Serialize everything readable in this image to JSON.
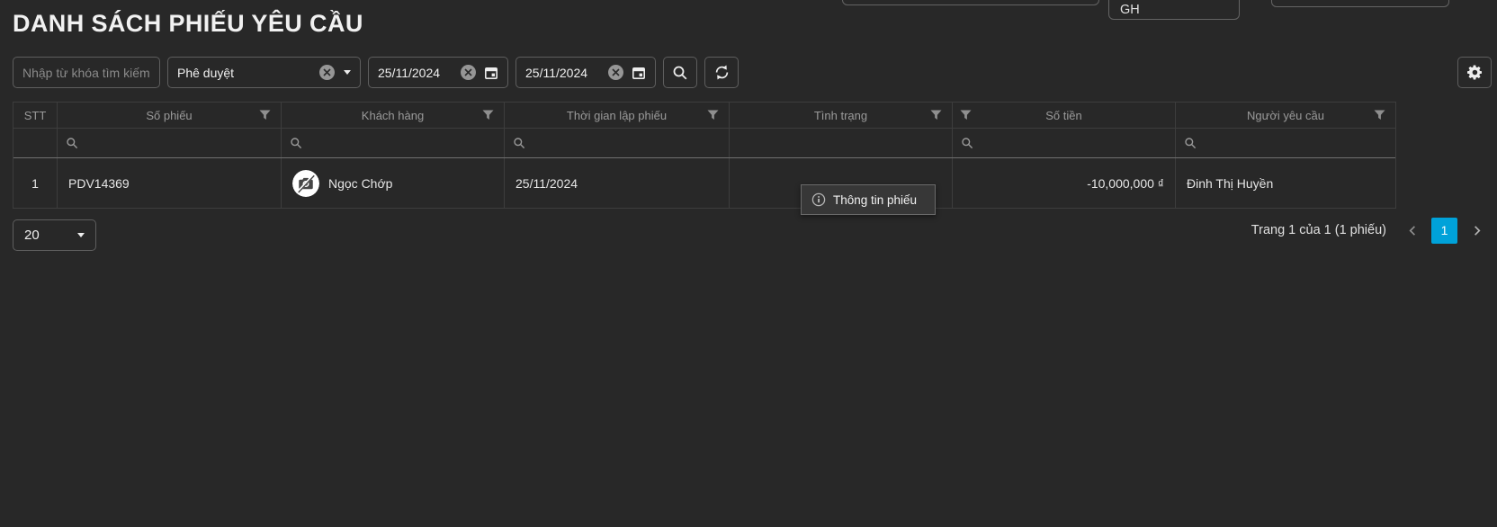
{
  "page": {
    "title": "DANH SÁCH PHIẾU YÊU CẦU"
  },
  "top_edge": {
    "partial_input_value": "GH"
  },
  "toolbar": {
    "search_placeholder": "Nhập từ khóa tìm kiếm",
    "status_filter_value": "Phê duyệt",
    "date_from": "25/11/2024",
    "date_to": "25/11/2024"
  },
  "table": {
    "columns": [
      {
        "label": "STT",
        "filter": false
      },
      {
        "label": "Số phiếu",
        "filter": true
      },
      {
        "label": "Khách hàng",
        "filter": true
      },
      {
        "label": "Thời gian lập phiếu",
        "filter": true
      },
      {
        "label": "Tình trạng",
        "filter": true
      },
      {
        "label": "Số tiền",
        "filter": true
      },
      {
        "label": "Người yêu cầu",
        "filter": true
      }
    ],
    "rows": [
      {
        "stt": "1",
        "so_phieu": "PDV14369",
        "khach_hang": "Ngọc Chớp",
        "thoi_gian_lap_phieu": "25/11/2024",
        "tinh_trang": "",
        "so_tien": "-10,000,000 ₫",
        "nguoi_yeu_cau": "Đinh Thị Huyền"
      }
    ],
    "row_tooltip": {
      "label": "Thông tin phiếu"
    }
  },
  "pager": {
    "page_size": "20",
    "info": "Trang 1 của 1 (1 phiếu)",
    "current_page": "1"
  },
  "colors": {
    "background": "#282828",
    "accent": "#00a2d9",
    "control_border": "#5e5e5e",
    "table_border": "#3d3d3d",
    "header_text": "#9a9a9a"
  },
  "icons": {
    "clear": "circle-x",
    "dropdown": "caret-down",
    "calendar": "calendar",
    "search": "magnifier",
    "refresh": "refresh-arrows",
    "settings": "gear",
    "filter": "funnel",
    "column_search": "magnifier",
    "info": "info-circle",
    "avatar_placeholder": "camera-off",
    "prev_page": "chevron-left",
    "next_page": "chevron-right"
  }
}
